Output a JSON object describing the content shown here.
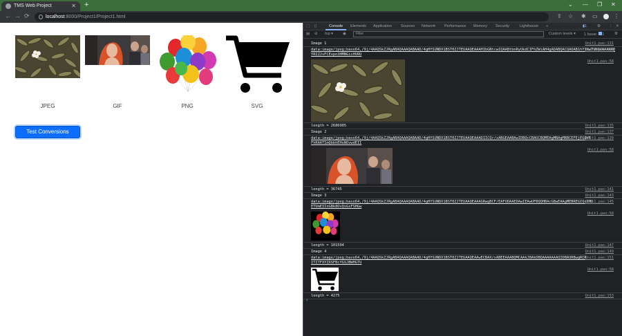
{
  "browser": {
    "tab_title": "TMS Web Project",
    "tab_close": "✕",
    "new_tab": "+",
    "window_controls": [
      "⌄",
      "—",
      "❐",
      "✕"
    ],
    "url_host": "localhost",
    "url_path": ":8000/Project1/Project1.html",
    "nav": [
      "←",
      "→",
      "⟳"
    ],
    "toolbar_icons": [
      "⇪",
      "☆",
      "✱",
      "▭",
      "⋮"
    ]
  },
  "page": {
    "captions": [
      "JPEG",
      "GIF",
      "PNG",
      "SVG"
    ],
    "button_label": "Test Conversions"
  },
  "devtools": {
    "tabs": [
      "Console",
      "Elements",
      "Application",
      "Sources",
      "Network",
      "Performance",
      "Memory",
      "Security",
      "Lighthouse",
      "»"
    ],
    "badge": "1",
    "context": "top ▾",
    "filter_placeholder": "Filter",
    "levels": "Custom levels ▾",
    "issues": "1 Issue:",
    "issues_count": "1",
    "console": {
      "img1_label": "Image 1",
      "img1_data": "data:image/jpeg;base64,/9j/4AAQSkZJRgABAQAAAQABAAD/4gHYSUNDX1BST0ZJTEUAAQEAAAHIbGNtcwIQAABtbnRyUkdCIFhZWiAH4gADABQACQAOAB1hY3NwTVNGVAAAAABzYXdzY3RybAAAAAA",
      "img1_data2": "YRIZJvFCExpn3HMNGiiHVRU",
      "img1_len": "length = 2686905",
      "img2_label": "Image 2",
      "img2_data": "data:image/jpeg;base64,/9j/4AAQSkZJRgABAQAAAQABAAD/4gHYSUNDX1BST0ZJTEUAAQEAAADIICQr/xABGEAABAwIDBQcCBAUCBQMEAgMBAgMRBCEFEjEGQVE",
      "img2_data2": "FhRAATImQbbhEHoNOvwdEII",
      "img2_len": "length = 36745",
      "img3_label": "Image 3",
      "img3_data": "data:image/jpeg;base64,/9j/4AAQSkZJRgABAQAAAQABAAD/4gHYSUNDX1BST0ZJTEUAAQEAAAGRwgBCF/EAFUDAAEDAwIEAwUFBQQHBAcGBwEAAgMEBREGIQcSMU",
      "img3_data2": "ETUmEIInGBk8OvQsGxFSHGw",
      "img3_len": "length = 101594",
      "img4_label": "Image 4",
      "img4_data": "data:image/jpeg;base64,/9j/4AAQSkZJRgABAQAAAQABAAD/4gHYSUNDX1BST0ZJTEUAAQEAAwECBAX/xABEEAAABQMCAAkJBAkOBQAAAAAAAQIDBAURBwgRCR",
      "img4_data2": "ITITFXYZXSFBcYGSJBWHGTU",
      "img4_len": "length = 4275",
      "sources": [
        "Unit1.pas:131",
        "Unit1.pas:133",
        "Unit1.pas:58",
        "Unit1.pas:135",
        "Unit1.pas:137",
        "Unit1.pas:139",
        "Unit1.pas:58",
        "Unit1.pas:141",
        "Unit1.pas:143",
        "Unit1.pas:145",
        "Unit1.pas:58",
        "Unit1.pas:147",
        "Unit1.pas:149",
        "Unit1.pas:151",
        "Unit1.pas:58",
        "Unit1.pas:153"
      ],
      "prompt": "›"
    }
  }
}
